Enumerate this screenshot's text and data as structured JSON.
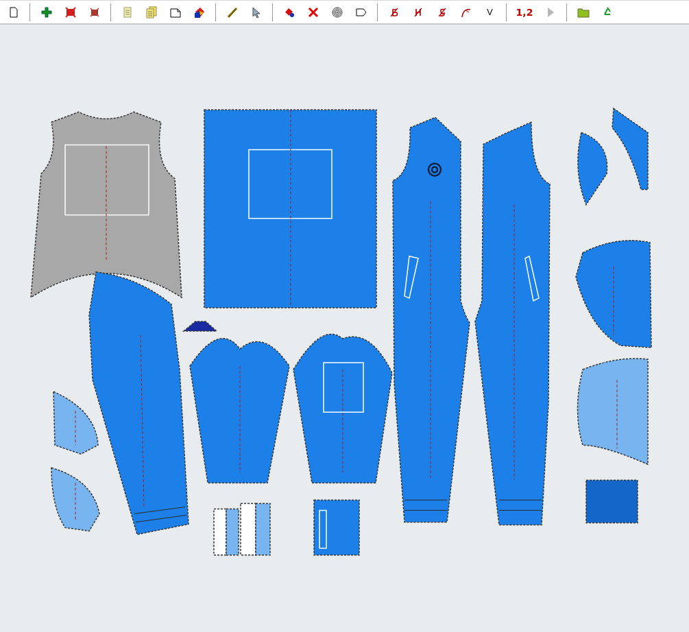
{
  "toolbar": {
    "letter_button": "V",
    "scale_button": "1,2",
    "next_disabled": true
  }
}
